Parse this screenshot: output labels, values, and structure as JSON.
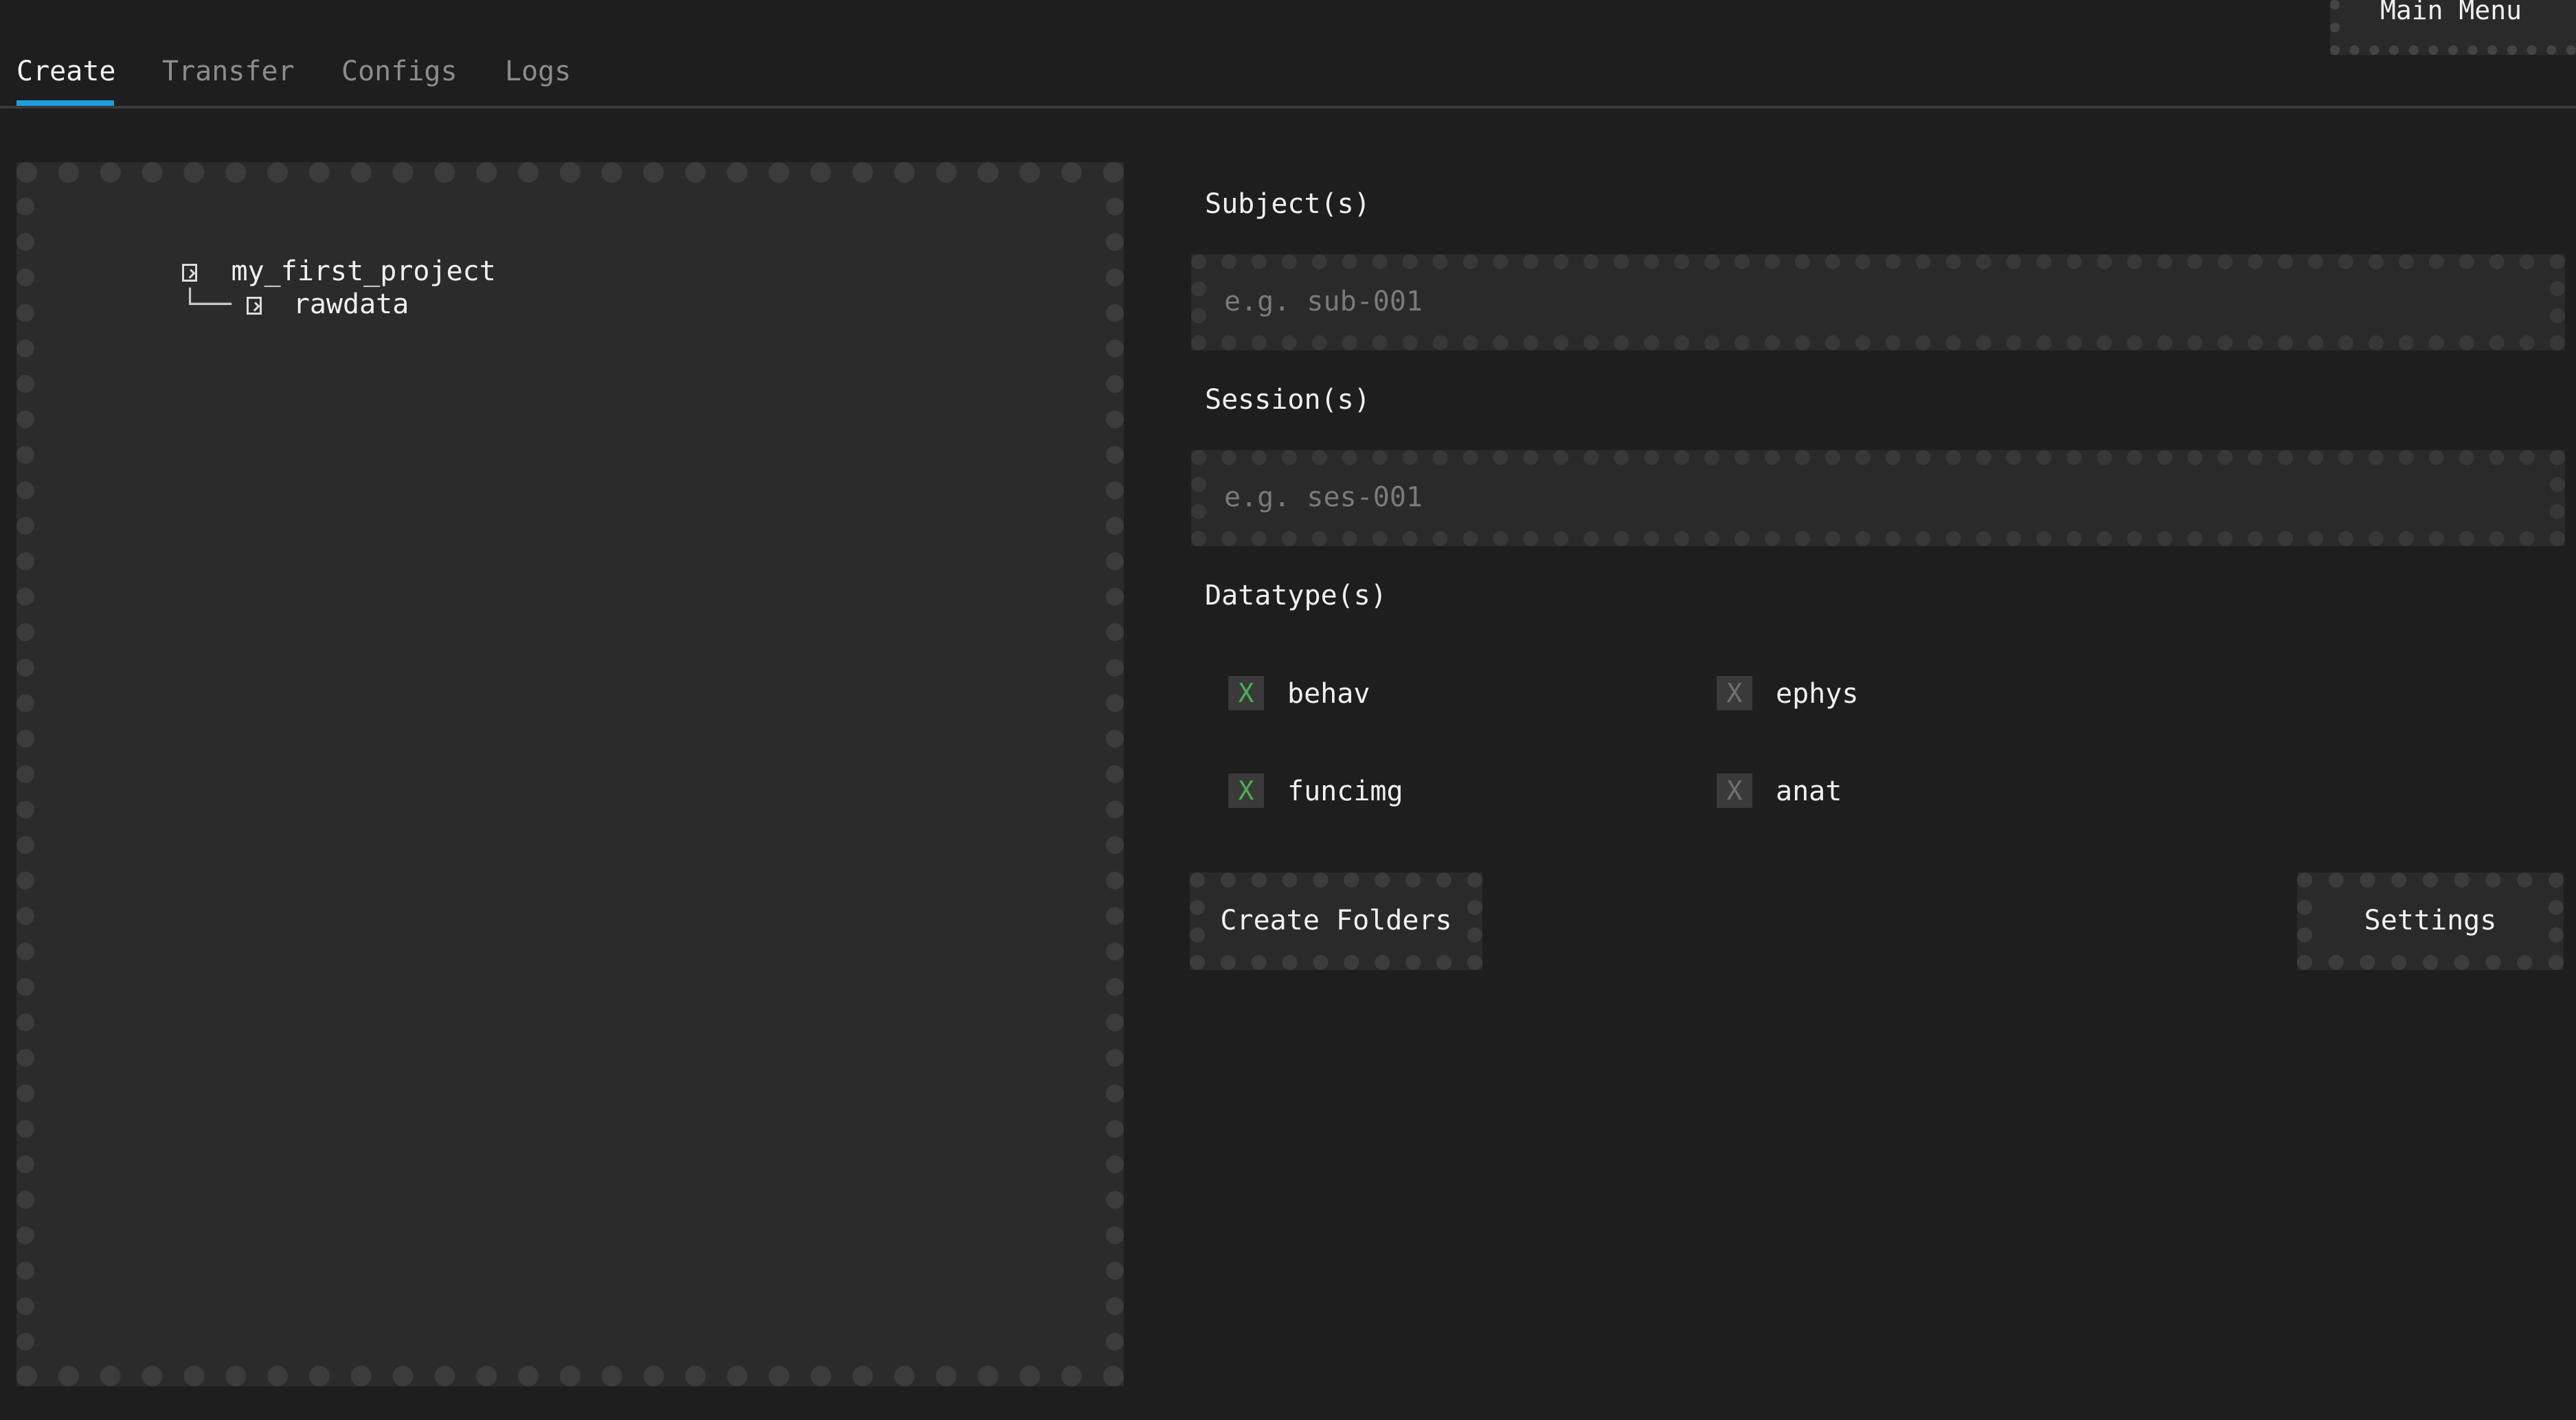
{
  "main_menu": {
    "label": "Main Menu"
  },
  "tabs": [
    {
      "label": "Create",
      "active": true
    },
    {
      "label": "Transfer",
      "active": false
    },
    {
      "label": "Configs",
      "active": false
    },
    {
      "label": "Logs",
      "active": false
    }
  ],
  "tree": {
    "root": "my_first_project",
    "children": [
      {
        "label": "rawdata",
        "branch": "└──"
      }
    ]
  },
  "form": {
    "subject": {
      "label": "Subject(s)",
      "placeholder": "e.g. sub-001",
      "value": ""
    },
    "session": {
      "label": "Session(s)",
      "placeholder": "e.g. ses-001",
      "value": ""
    },
    "datatype": {
      "label": "Datatype(s)",
      "options": [
        {
          "label": "behav",
          "checked": true,
          "mark": "X"
        },
        {
          "label": "ephys",
          "checked": false,
          "mark": "X"
        },
        {
          "label": "funcimg",
          "checked": true,
          "mark": "X"
        },
        {
          "label": "anat",
          "checked": false,
          "mark": "X"
        }
      ]
    },
    "create_button": "Create Folders",
    "settings_button": "Settings"
  },
  "colors": {
    "background": "#1e1e1e",
    "panel": "#2b2b2b",
    "accent": "#1b9fe0",
    "checked": "#4caf50"
  }
}
